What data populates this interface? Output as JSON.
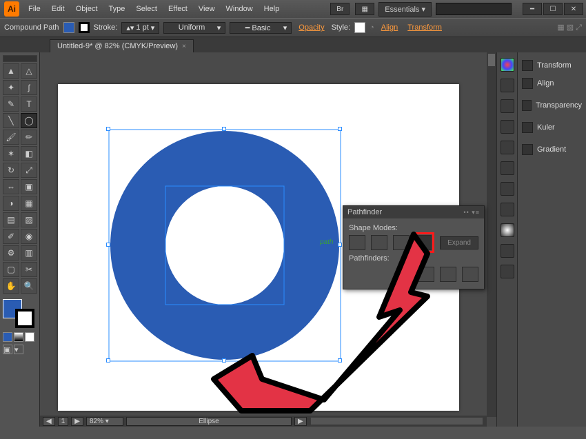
{
  "app": {
    "abbr": "Ai"
  },
  "menus": [
    "File",
    "Edit",
    "Object",
    "Type",
    "Select",
    "Effect",
    "View",
    "Window",
    "Help"
  ],
  "workspace": {
    "name": "Essentials"
  },
  "window_controls": {
    "min": "━",
    "max": "☐",
    "close": "✕"
  },
  "controlbar": {
    "obj_type": "Compound Path",
    "fill_color": "#2a5cb3",
    "stroke_label": "Stroke:",
    "stroke_weight": "1 pt",
    "brush": "Uniform",
    "style_label": "Basic",
    "opacity_label": "Opacity",
    "style2_label": "Style:",
    "align_link": "Align",
    "transform_link": "Transform"
  },
  "tab": {
    "title": "Untitled-9* @ 82% (CMYK/Preview)"
  },
  "canvas": {
    "shape_fill": "#2a5cb3",
    "path_label": "path",
    "sel_color": "#2a8cff"
  },
  "status": {
    "nav_left": "◀",
    "page": "1",
    "nav_right": "▶",
    "zoom": "82%",
    "tool": "Ellipse",
    "next": "▶"
  },
  "right_panels": [
    "Transform",
    "Align",
    "Transparency",
    "Kuler",
    "Gradient"
  ],
  "pathfinder": {
    "title": "Pathfinder",
    "shape_modes_label": "Shape Modes:",
    "expand_label": "Expand",
    "pathfinders_label": "Pathfinders:"
  },
  "tools": {
    "fill": "#2a5cb3"
  }
}
